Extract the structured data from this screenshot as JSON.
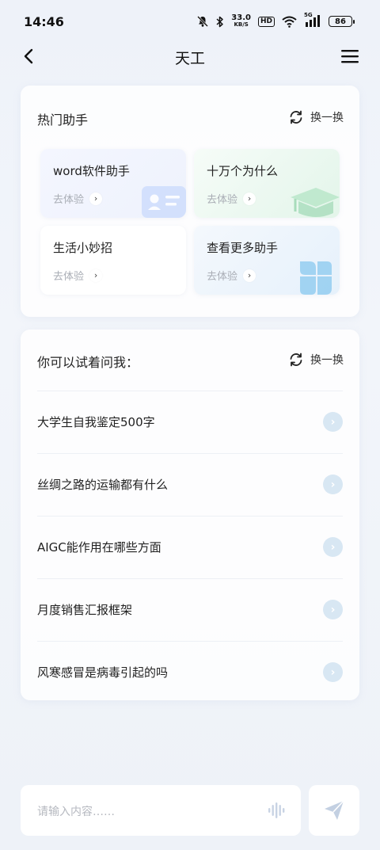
{
  "status_bar": {
    "time": "14:46",
    "net_speed": "33.0",
    "net_unit": "KB/S",
    "hd": "HD",
    "signal_label": "5G",
    "battery": "86"
  },
  "nav": {
    "title": "天工",
    "back_icon": "chevron-left-icon",
    "menu_icon": "hamburger-menu-icon"
  },
  "assistants": {
    "title": "热门助手",
    "refresh_label": "换一换",
    "items": [
      {
        "title": "word软件助手",
        "cta": "去体验",
        "icon": "id-card-icon"
      },
      {
        "title": "十万个为什么",
        "cta": "去体验",
        "icon": "graduation-cap-icon"
      },
      {
        "title": "生活小妙招",
        "cta": "去体验",
        "icon": ""
      },
      {
        "title": "查看更多助手",
        "cta": "去体验",
        "icon": "four-petal-grid-icon"
      }
    ]
  },
  "questions": {
    "title": "你可以试着问我：",
    "refresh_label": "换一换",
    "items": [
      "大学生自我鉴定500字",
      "丝绸之路的运输都有什么",
      "AIGC能作用在哪些方面",
      "月度销售汇报框架",
      "风寒感冒是病毒引起的吗"
    ]
  },
  "input": {
    "placeholder": "请输入内容……",
    "voice_icon": "voice-wave-icon",
    "send_icon": "paper-plane-icon"
  },
  "colors": {
    "background": "#eef2f9",
    "card": "#ffffff",
    "text": "#222222",
    "muted": "#a9adb5",
    "accent_light_blue": "#d8e7f3"
  }
}
